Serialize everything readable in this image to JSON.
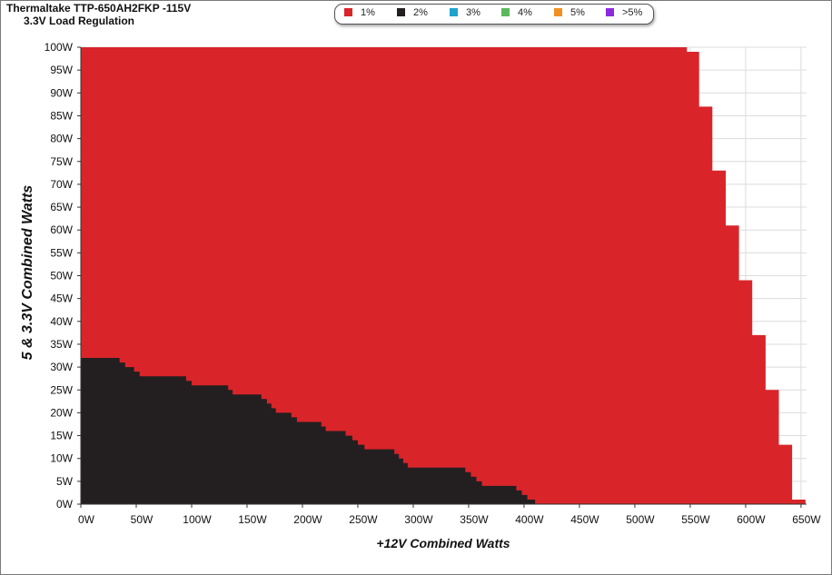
{
  "chart_data": {
    "type": "area",
    "title": "Thermaltake TTP-650AH2FKP -115V",
    "subtitle": "3.3V Load Regulation",
    "xlabel": "+12V Combined Watts",
    "ylabel": "5 & 3.3V Combined Watts",
    "xlim": [
      0,
      655
    ],
    "ylim": [
      0,
      100
    ],
    "x_ticks": [
      "0W",
      "50W",
      "100W",
      "150W",
      "200W",
      "250W",
      "300W",
      "350W",
      "400W",
      "450W",
      "500W",
      "550W",
      "600W",
      "650W"
    ],
    "y_ticks": [
      "0W",
      "5W",
      "10W",
      "15W",
      "20W",
      "25W",
      "30W",
      "35W",
      "40W",
      "45W",
      "50W",
      "55W",
      "60W",
      "65W",
      "70W",
      "75W",
      "80W",
      "85W",
      "90W",
      "95W",
      "100W"
    ],
    "grid": true,
    "legend_position": "top-center",
    "legend": [
      {
        "label": "1%",
        "color": "#d9252a"
      },
      {
        "label": "2%",
        "color": "#231f20"
      },
      {
        "label": "3%",
        "color": "#1ea3cf"
      },
      {
        "label": "4%",
        "color": "#5cb85c"
      },
      {
        "label": "5%",
        "color": "#f0901e"
      },
      {
        "label": ">5%",
        "color": "#8a2be2"
      }
    ],
    "series": [
      {
        "name": "1%",
        "color": "#d9252a",
        "boundary": [
          [
            0,
            100
          ],
          [
            547,
            100
          ],
          [
            547,
            99
          ],
          [
            558,
            99
          ],
          [
            558,
            87
          ],
          [
            570,
            87
          ],
          [
            570,
            73
          ],
          [
            582,
            73
          ],
          [
            582,
            61
          ],
          [
            594,
            61
          ],
          [
            594,
            49
          ],
          [
            606,
            49
          ],
          [
            606,
            37
          ],
          [
            618,
            37
          ],
          [
            618,
            25
          ],
          [
            630,
            25
          ],
          [
            630,
            13
          ],
          [
            642,
            13
          ],
          [
            642,
            1
          ],
          [
            654,
            1
          ],
          [
            654,
            0
          ]
        ]
      },
      {
        "name": "2%",
        "color": "#231f20",
        "boundary": [
          [
            0,
            32
          ],
          [
            35,
            32
          ],
          [
            35,
            31
          ],
          [
            40,
            31
          ],
          [
            40,
            30
          ],
          [
            48,
            30
          ],
          [
            48,
            29
          ],
          [
            53,
            29
          ],
          [
            53,
            28
          ],
          [
            95,
            28
          ],
          [
            95,
            27
          ],
          [
            100,
            27
          ],
          [
            100,
            26
          ],
          [
            133,
            26
          ],
          [
            133,
            25
          ],
          [
            137,
            25
          ],
          [
            137,
            24
          ],
          [
            163,
            24
          ],
          [
            163,
            23
          ],
          [
            168,
            23
          ],
          [
            168,
            22
          ],
          [
            172,
            22
          ],
          [
            172,
            21
          ],
          [
            176,
            21
          ],
          [
            176,
            20
          ],
          [
            190,
            20
          ],
          [
            190,
            19
          ],
          [
            195,
            19
          ],
          [
            195,
            18
          ],
          [
            217,
            18
          ],
          [
            217,
            17
          ],
          [
            221,
            17
          ],
          [
            221,
            16
          ],
          [
            239,
            16
          ],
          [
            239,
            15
          ],
          [
            245,
            15
          ],
          [
            245,
            14
          ],
          [
            250,
            14
          ],
          [
            250,
            13
          ],
          [
            256,
            13
          ],
          [
            256,
            12
          ],
          [
            283,
            12
          ],
          [
            283,
            11
          ],
          [
            287,
            11
          ],
          [
            287,
            10
          ],
          [
            291,
            10
          ],
          [
            291,
            9
          ],
          [
            295,
            9
          ],
          [
            295,
            8
          ],
          [
            347,
            8
          ],
          [
            347,
            7
          ],
          [
            352,
            7
          ],
          [
            352,
            6
          ],
          [
            357,
            6
          ],
          [
            357,
            5
          ],
          [
            362,
            5
          ],
          [
            362,
            4
          ],
          [
            393,
            4
          ],
          [
            393,
            3
          ],
          [
            398,
            3
          ],
          [
            398,
            2
          ],
          [
            403,
            2
          ],
          [
            403,
            1
          ],
          [
            410,
            1
          ],
          [
            410,
            0
          ]
        ]
      }
    ]
  }
}
